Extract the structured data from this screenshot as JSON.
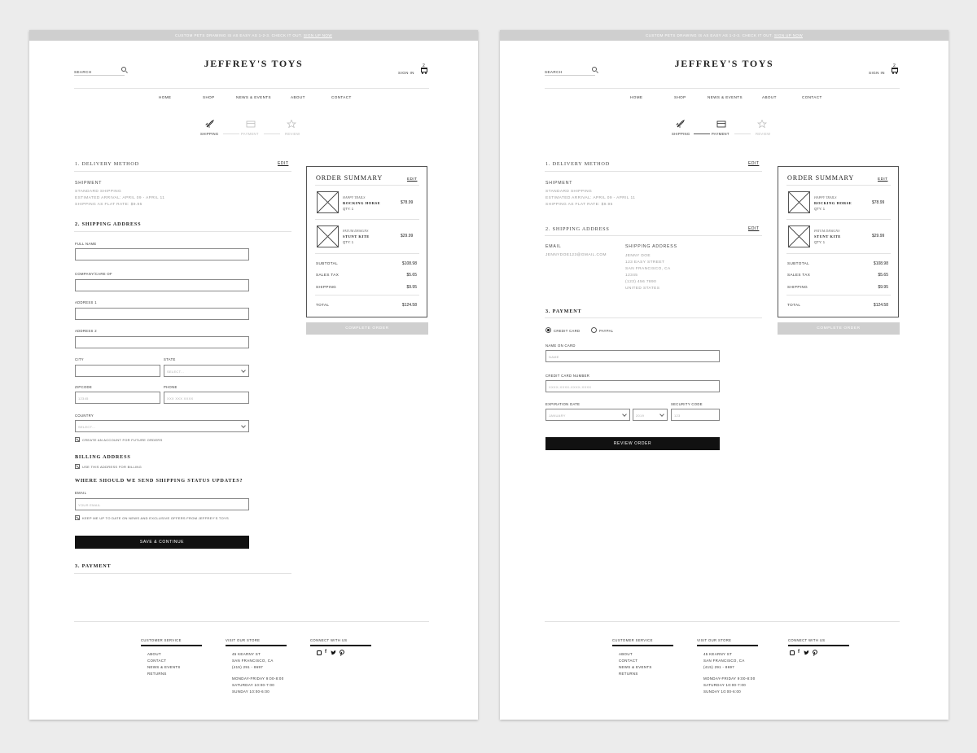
{
  "banner": {
    "text": "CUSTOM PETS DRAWING IS AS EASY AS 1-2-3. CHECK IT OUT. ",
    "link": "SIGN UP NOW"
  },
  "brand": "JEFFREY'S TOYS",
  "header": {
    "search_label": "SEARCH",
    "sign_in": "SIGN IN",
    "cart_count": "2",
    "icons": [
      "search-icon",
      "cart-icon"
    ]
  },
  "nav": [
    "HOME",
    "SHOP",
    "NEWS & EVENTS",
    "ABOUT",
    "CONTACT"
  ],
  "steps": [
    {
      "label": "SHIPPING",
      "icon": "rocket-icon"
    },
    {
      "label": "PAYMENT",
      "icon": "card-icon"
    },
    {
      "label": "REVIEW",
      "icon": "star-icon"
    }
  ],
  "edit": "EDIT",
  "delivery": {
    "title": "1. DELIVERY METHOD",
    "method": "SHIPMENT",
    "lines": [
      "STANDARD SHIPPING",
      "ESTIMATED ARRIVAL: APRIL 09 - APRIL 11",
      "SHIPPING AS FLAT RATE: $9.95"
    ]
  },
  "shipping_form": {
    "title": "2. SHIPPING ADDRESS",
    "full_name": "FULL NAME",
    "company": "COMPANY/CARE OF",
    "address1": "ADDRESS 1",
    "address2": "ADDRESS 2",
    "city": "CITY",
    "state": "STATE",
    "state_placeholder": "SELECT...",
    "zip": "ZIPCODE",
    "zip_placeholder": "12345",
    "phone": "PHONE",
    "phone_placeholder": "XXX XXX XXXX",
    "country": "COUNTRY",
    "country_placeholder": "SELECT...",
    "create_account": "CREATE AN ACCOUNT FOR FUTURE ORDERS",
    "billing_title": "BILLING ADDRESS",
    "billing_same": "USE THIS ADDRESS FOR BILLING",
    "updates_title": "WHERE SHOULD WE SEND SHIPPING STATUS UPDATES?",
    "email": "EMAIL",
    "email_placeholder": "YOUR EMAIL",
    "newsletter": "KEEP ME UP TO DATE ON NEWS AND EXCLUSIVE OFFERS FROM JEFFREY'S TOYS",
    "save_button": "SAVE & CONTINUE",
    "payment_title": "3. PAYMENT"
  },
  "summary": {
    "title": "ORDER SUMMARY",
    "items": [
      {
        "brand": "HAPPY TRAILS",
        "name": "ROCKING HORSE",
        "qty": "QTY: 1",
        "price": "$78.99"
      },
      {
        "brand": "FATUM DESIGNS",
        "name": "STUNT KITE",
        "qty": "QTY: 1",
        "price": "$29.99"
      }
    ],
    "totals": [
      {
        "label": "SUBTOTAL",
        "value": "$108.98"
      },
      {
        "label": "SALES TAX",
        "value": "$5.65"
      },
      {
        "label": "SHIPPING",
        "value": "$9.95"
      }
    ],
    "total": {
      "label": "TOTAL",
      "value": "$124.58"
    },
    "complete_button": "COMPLETE ORDER"
  },
  "shipping_review": {
    "title": "2. SHIPPING ADDRESS",
    "email_label": "EMAIL",
    "email": "JENNYDOE123@GMAIL.COM",
    "address_label": "SHIPPING ADDRESS",
    "address_lines": [
      "JENNY DOE",
      "123 EASY STREET",
      "SAN FRANCISCO, CA",
      "12345",
      "(123) 456 7890",
      "UNITED STATES"
    ]
  },
  "payment": {
    "title": "3. PAYMENT",
    "credit": "CREDIT CARD",
    "paypal": "PAYPAL",
    "name_label": "NAME ON CARD",
    "name_placeholder": "NAME",
    "card_label": "CREDIT CARD NUMBER",
    "card_placeholder": "XXXX-XXXX-XXXX-XXXX",
    "exp_label": "EXPIRATION DATE",
    "month_placeholder": "JANUARY",
    "year_placeholder": "2019",
    "cvc_label": "SECURITY CODE",
    "cvc_placeholder": "123",
    "review_button": "REVIEW ORDER"
  },
  "footer": {
    "customer_service": {
      "title": "CUSTOMER SERVICE",
      "links": [
        "ABOUT",
        "CONTACT",
        "NEWS & EVENTS",
        "RETURNS"
      ]
    },
    "visit": {
      "title": "VISIT OUR STORE",
      "address": [
        "45 KEARNY ST",
        "SAN FRANCISCO, CA",
        "(415) 291 - 8697"
      ],
      "hours": [
        "MONDAY-FRIDAY 9:00-8:00",
        "SATURDAY 10:00-7:00",
        "SUNDAY 10:00-6:00"
      ]
    },
    "connect": {
      "title": "CONNECT WITH US",
      "icons": [
        "instagram-icon",
        "facebook-icon",
        "twitter-icon",
        "pinterest-icon"
      ]
    }
  }
}
